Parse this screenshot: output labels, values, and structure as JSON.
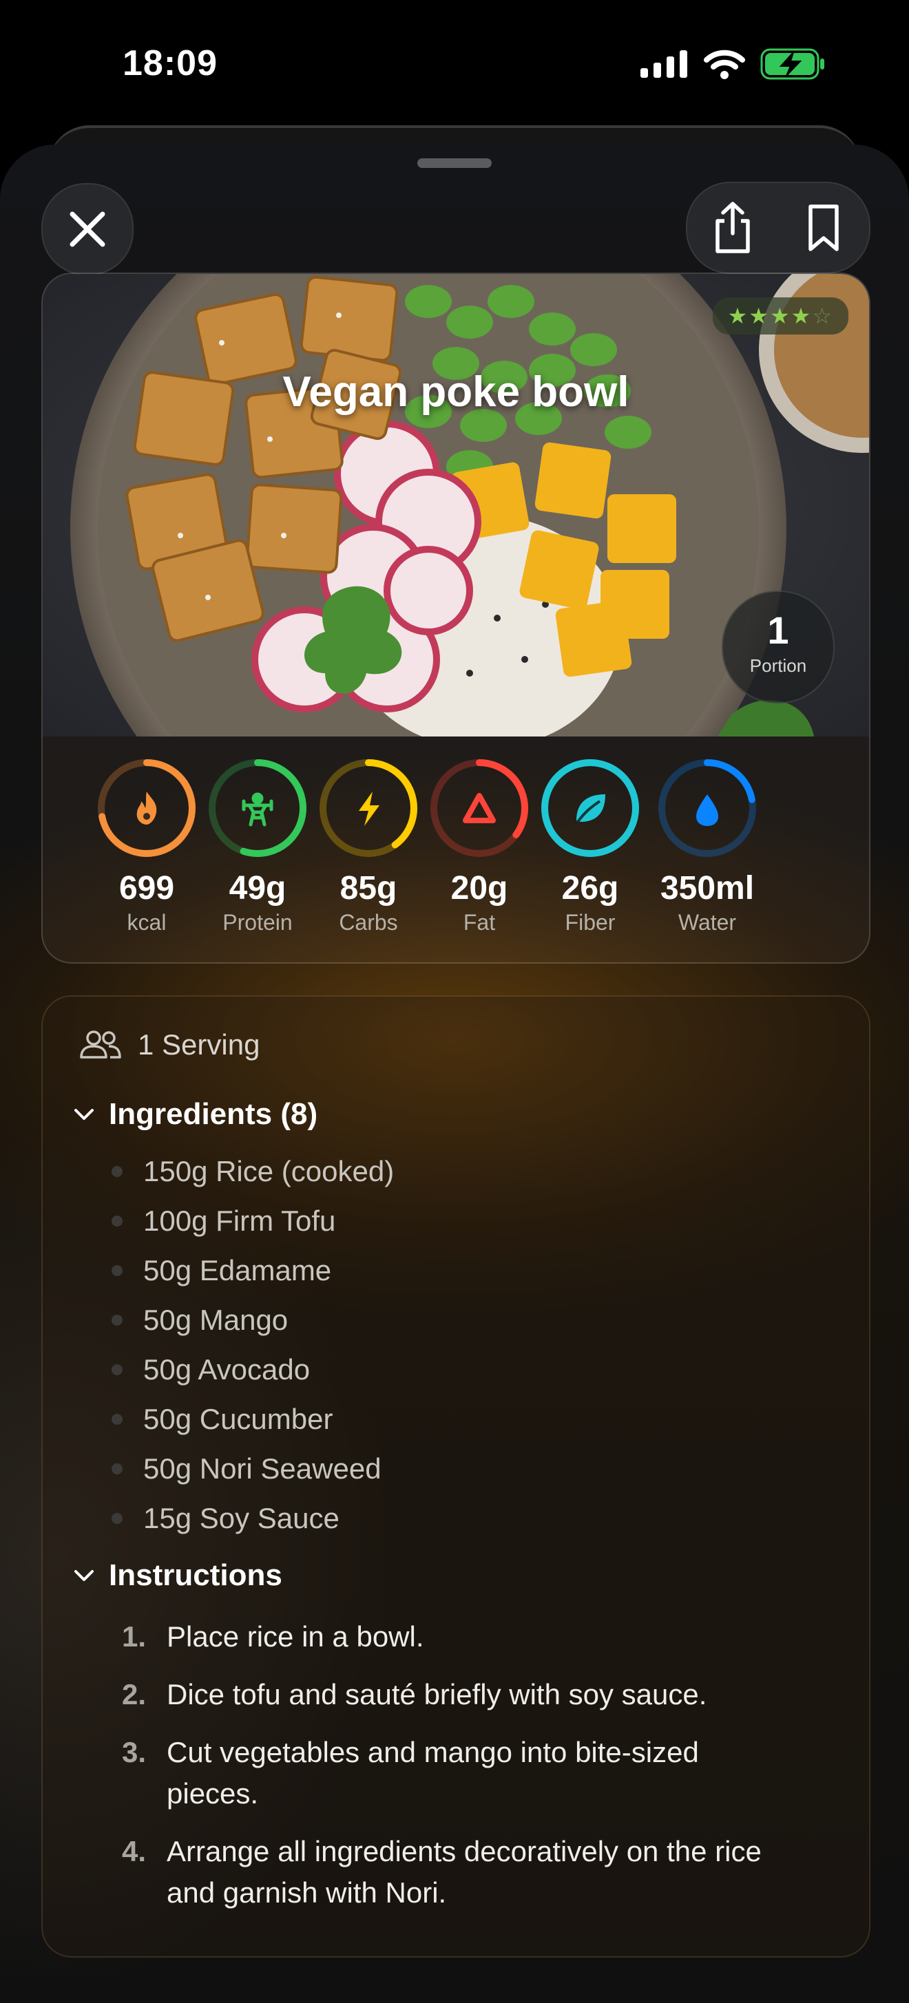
{
  "status_bar": {
    "time": "18:09"
  },
  "header": {
    "close_icon": "close-icon",
    "share_icon": "share-icon",
    "bookmark_icon": "bookmark-icon"
  },
  "recipe": {
    "title": "Vegan poke bowl",
    "rating": {
      "value": 4,
      "max": 5
    },
    "portion": {
      "count": "1",
      "label": "Portion"
    }
  },
  "nutrients": [
    {
      "value": "699",
      "label": "kcal",
      "icon": "flame-icon",
      "color": "#f5913a",
      "fill": 0.72
    },
    {
      "value": "49g",
      "label": "Protein",
      "icon": "weightlifter-icon",
      "color": "#34c759",
      "fill": 0.55
    },
    {
      "value": "85g",
      "label": "Carbs",
      "icon": "bolt-icon",
      "color": "#ffcc00",
      "fill": 0.4
    },
    {
      "value": "20g",
      "label": "Fat",
      "icon": "triangle-icon",
      "color": "#ff453a",
      "fill": 0.35
    },
    {
      "value": "26g",
      "label": "Fiber",
      "icon": "leaf-icon",
      "color": "#1fc7d4",
      "fill": 1.0
    },
    {
      "value": "350ml",
      "label": "Water",
      "icon": "drop-icon",
      "color": "#0a84ff",
      "fill": 0.22
    }
  ],
  "servings": {
    "label": "1 Serving",
    "icon": "people-icon"
  },
  "ingredients": {
    "title": "Ingredients (8)",
    "items": [
      "150g Rice (cooked)",
      "100g Firm Tofu",
      "50g Edamame",
      "50g Mango",
      "50g Avocado",
      "50g Cucumber",
      "50g Nori Seaweed",
      "15g Soy Sauce"
    ]
  },
  "instructions": {
    "title": "Instructions",
    "steps": [
      {
        "num": "1.",
        "text": "Place rice in a bowl."
      },
      {
        "num": "2.",
        "text": "Dice tofu and sauté briefly with soy sauce."
      },
      {
        "num": "3.",
        "text": "Cut vegetables and mango into bite-sized pieces."
      },
      {
        "num": "4.",
        "text": "Arrange all ingredients decoratively on the rice and garnish with Nori."
      }
    ]
  }
}
